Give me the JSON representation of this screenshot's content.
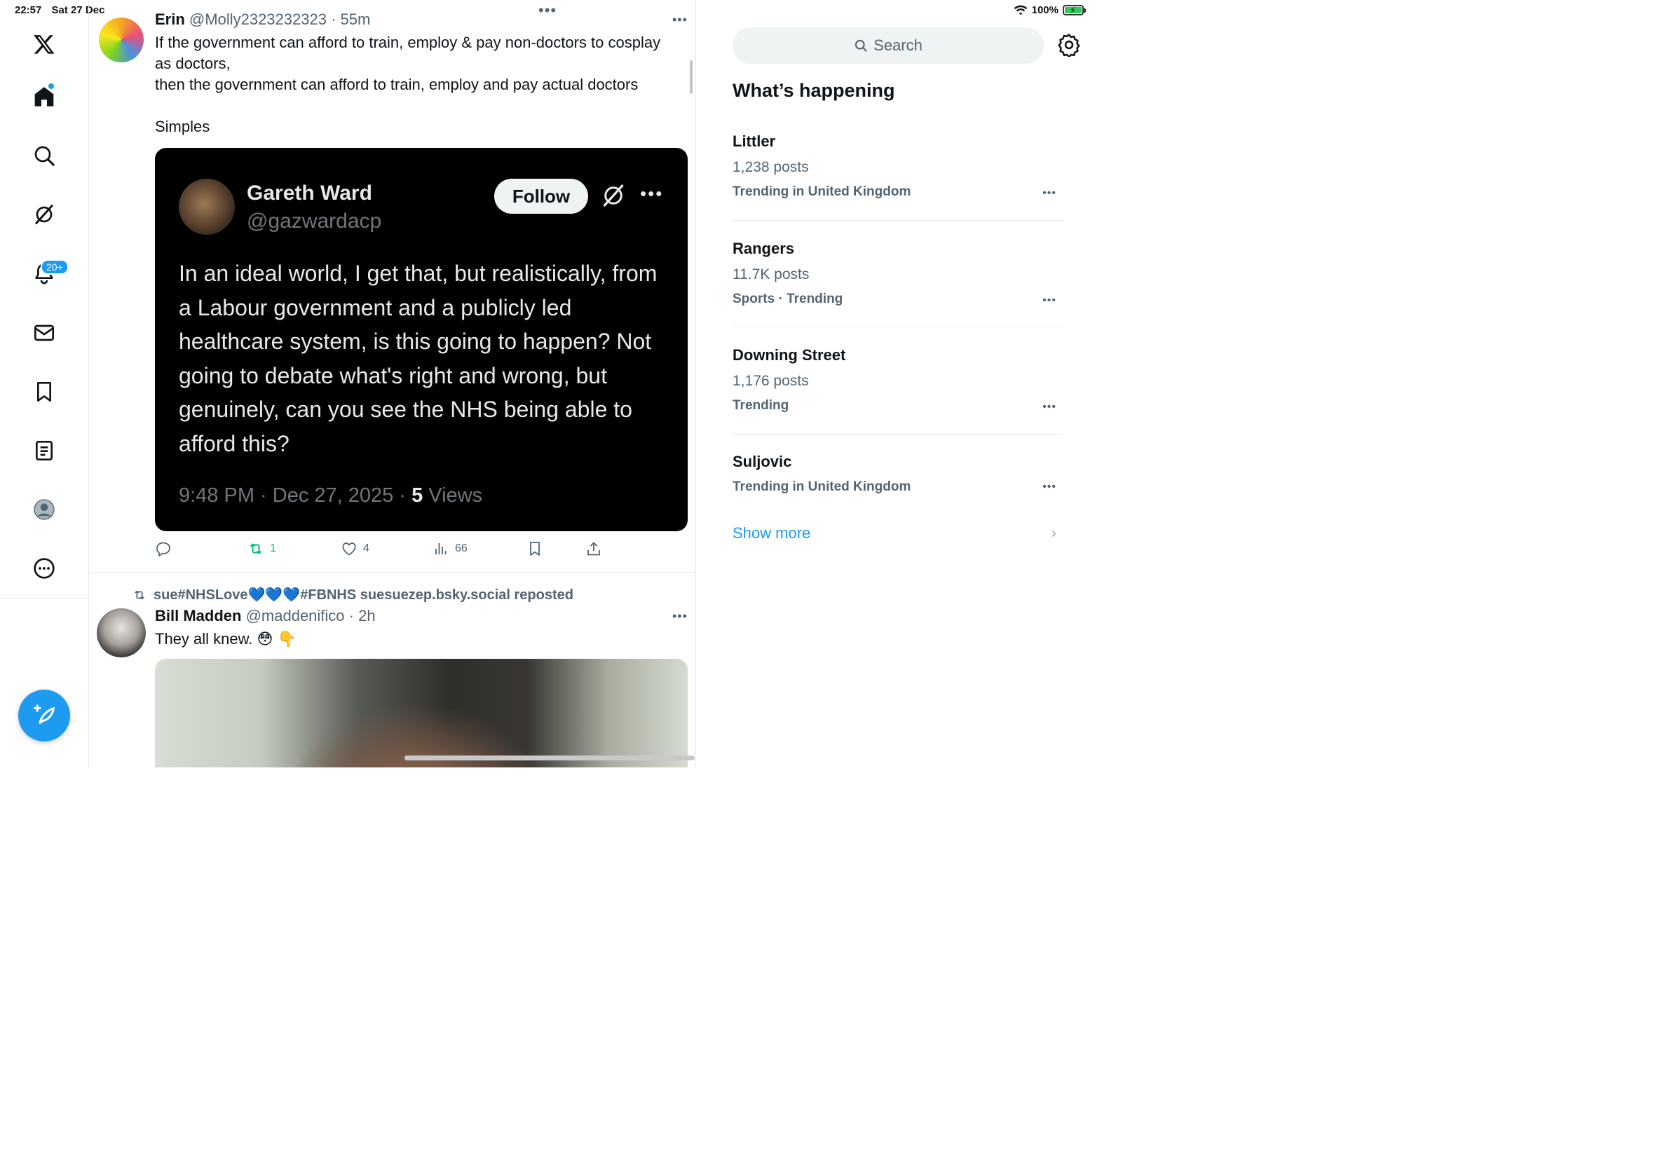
{
  "status_bar": {
    "time": "22:57",
    "date": "Sat 27 Dec",
    "battery": "100%",
    "colors": {
      "battery": "#34c759"
    }
  },
  "nav": {
    "items": [
      {
        "name": "x-logo",
        "icon": "x-logo-icon"
      },
      {
        "name": "home",
        "icon": "home-icon"
      },
      {
        "name": "explore",
        "icon": "search-icon"
      },
      {
        "name": "grok",
        "icon": "grok-icon"
      },
      {
        "name": "notifications",
        "icon": "bell-icon"
      },
      {
        "name": "messages",
        "icon": "mail-icon"
      },
      {
        "name": "bookmarks",
        "icon": "bookmark-icon"
      },
      {
        "name": "lists",
        "icon": "list-icon"
      },
      {
        "name": "profile",
        "icon": "profile-icon"
      },
      {
        "name": "more",
        "icon": "more-circle-icon"
      }
    ],
    "notification_badge": "20+",
    "compose_icon": "compose-feather-icon",
    "colors": {
      "accent": "#1d9bf0"
    }
  },
  "feed": {
    "tweet1": {
      "name": "Erin",
      "handle": "@Molly2323232323",
      "time": "55m",
      "text": "If the government can afford to train, employ & pay non-doctors to cosplay\nas doctors,\nthen the government can afford to train, employ and pay actual doctors\n\nSimples",
      "quote": {
        "name": "Gareth Ward",
        "handle": "@gazwardacp",
        "follow_label": "Follow",
        "text": "In an ideal world, I get that, but realistically, from a Labour government and a publicly led healthcare system, is this going to happen? Not going to debate what's right and wrong, but genuinely, can you see the NHS being able to afford this?",
        "time": "9:48 PM",
        "date": "Dec 27, 2025",
        "views_count": "5",
        "views_label": "Views"
      },
      "actions": {
        "reposts": "1",
        "likes": "4",
        "views": "66"
      }
    },
    "repost_line": "sue#NHSLove💙💙💙#FBNHS suesuezep.bsky.social reposted",
    "tweet2": {
      "name": "Bill Madden",
      "handle": "@maddenifico",
      "time": "2h",
      "text": "They all knew. 😳 👇"
    }
  },
  "sidebar": {
    "search_placeholder": "Search",
    "section_title": "What’s happening",
    "trends": [
      {
        "name": "Littler",
        "posts": "1,238 posts",
        "context": "Trending in United Kingdom"
      },
      {
        "name": "Rangers",
        "posts": "11.7K posts",
        "context": "Sports · Trending"
      },
      {
        "name": "Downing Street",
        "posts": "1,176 posts",
        "context": "Trending"
      },
      {
        "name": "Suljovic",
        "posts": "",
        "context": "Trending in United Kingdom"
      }
    ],
    "show_more": "Show more",
    "colors": {
      "link": "#1d9bf0",
      "retweet": "#00ba7c"
    }
  }
}
